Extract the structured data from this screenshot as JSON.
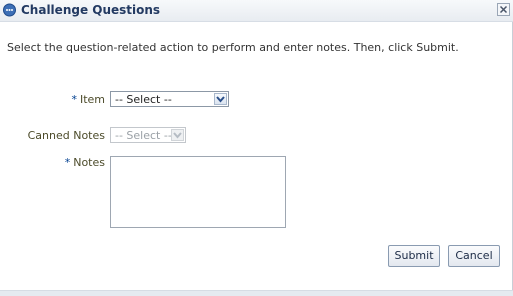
{
  "dialog": {
    "title": "Challenge Questions",
    "title_icon": "question-bubble-icon",
    "close_icon": "close-icon"
  },
  "instructions": "Select the question-related action to perform and enter notes. Then, click Submit.",
  "form": {
    "required_marker": "*",
    "item": {
      "label": "Item",
      "selected": "-- Select --",
      "required": true
    },
    "canned_notes": {
      "label": "Canned Notes",
      "selected": "-- Select --",
      "disabled": true
    },
    "notes": {
      "label": "Notes",
      "value": "",
      "required": true
    }
  },
  "buttons": {
    "submit": "Submit",
    "cancel": "Cancel"
  },
  "colors": {
    "title": "#233a62",
    "label": "#4c4b2a",
    "required": "#003f8f"
  }
}
